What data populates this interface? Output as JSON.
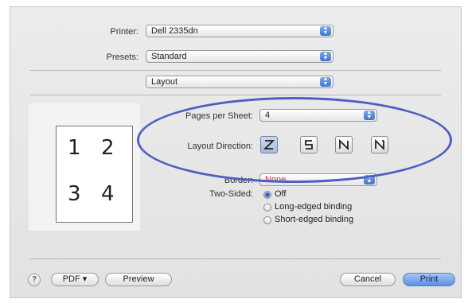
{
  "printer": {
    "label": "Printer:",
    "value": "Dell 2335dn"
  },
  "presets": {
    "label": "Presets:",
    "value": "Standard"
  },
  "section": {
    "value": "Layout"
  },
  "pages_per_sheet": {
    "label": "Pages per Sheet:",
    "value": "4"
  },
  "layout_direction": {
    "label": "Layout Direction:",
    "options": [
      "z-order",
      "s-order",
      "n-order-reverse",
      "n-order"
    ],
    "selected": 0
  },
  "border": {
    "label": "Border:",
    "value": "None"
  },
  "two_sided": {
    "label": "Two-Sided:",
    "options": [
      {
        "label": "Off",
        "selected": true
      },
      {
        "label": "Long-edged binding",
        "selected": false
      },
      {
        "label": "Short-edged binding",
        "selected": false
      }
    ]
  },
  "preview": {
    "numbers": [
      "1",
      "2",
      "3",
      "4"
    ]
  },
  "buttons": {
    "help": "?",
    "pdf": "PDF ▾",
    "preview": "Preview",
    "cancel": "Cancel",
    "print": "Print"
  },
  "colors": {
    "highlight_ellipse": "#4f5ec2",
    "accent": "#3b74d1",
    "selected_field": "#c43a3a"
  }
}
